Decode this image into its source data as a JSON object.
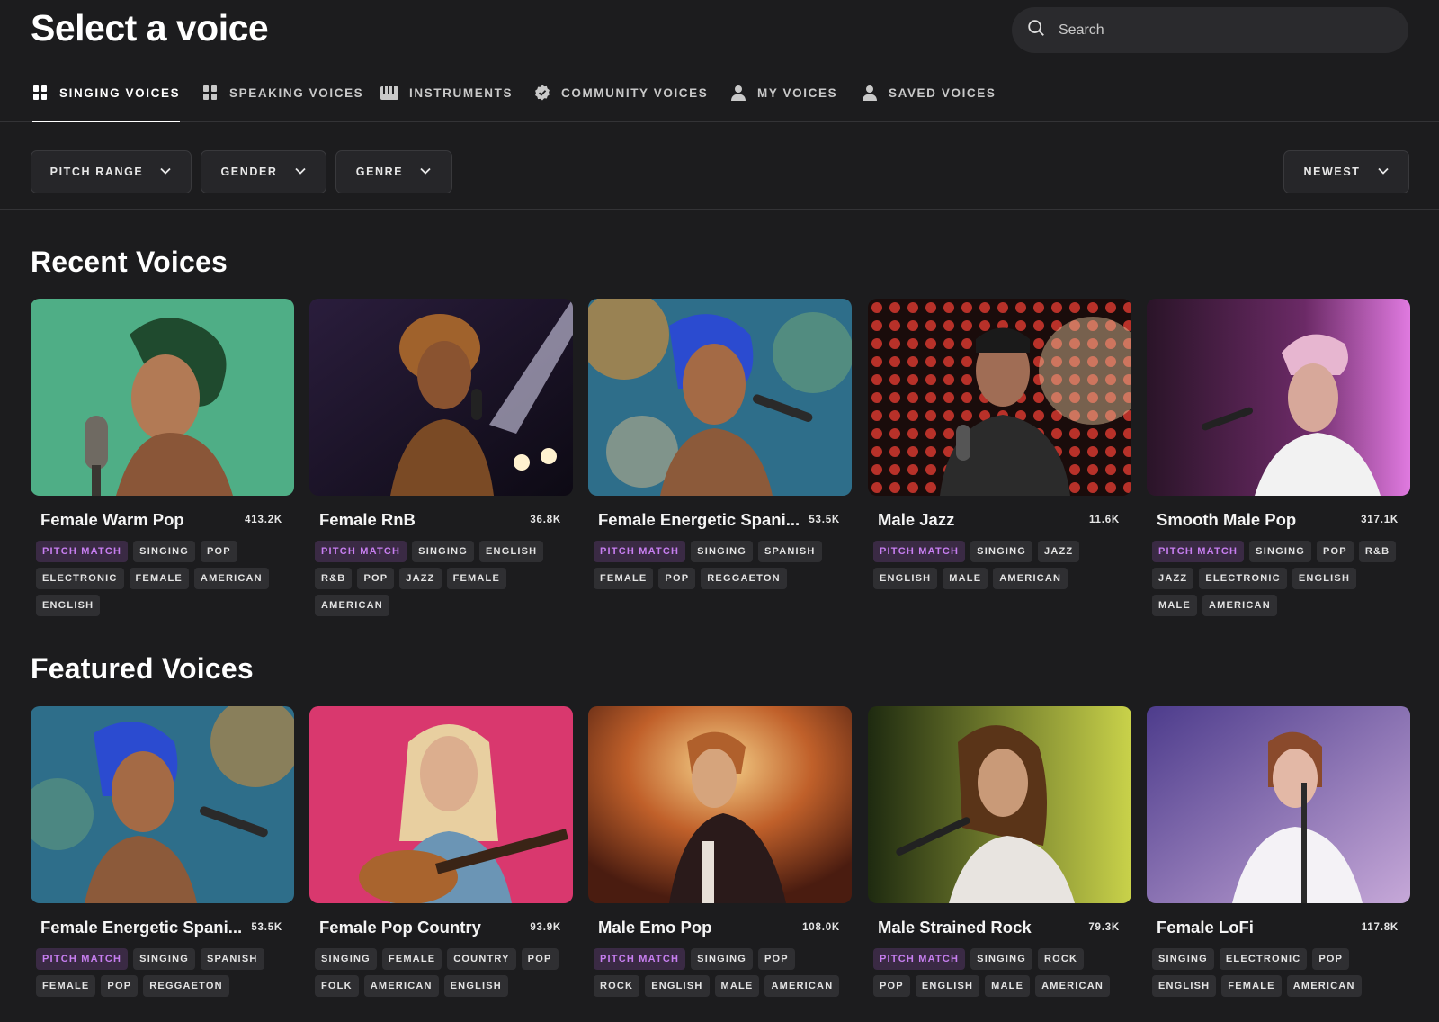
{
  "header": {
    "title": "Select a voice",
    "search_placeholder": "Search"
  },
  "tabs": [
    {
      "label": "SINGING VOICES",
      "icon": "mic-grid-icon",
      "active": true
    },
    {
      "label": "SPEAKING VOICES",
      "icon": "mic-grid-icon",
      "active": false
    },
    {
      "label": "INSTRUMENTS",
      "icon": "piano-icon",
      "active": false
    },
    {
      "label": "COMMUNITY VOICES",
      "icon": "verified-badge-icon",
      "active": false
    },
    {
      "label": "MY VOICES",
      "icon": "person-icon",
      "active": false
    },
    {
      "label": "SAVED VOICES",
      "icon": "person-icon",
      "active": false
    }
  ],
  "filters": {
    "pitch_range": "PITCH RANGE",
    "gender": "GENDER",
    "genre": "GENRE",
    "sort": "NEWEST"
  },
  "sections": {
    "recent": {
      "title": "Recent Voices",
      "cards": [
        {
          "name": "Female Warm Pop",
          "count": "413.2K",
          "tags": [
            "PITCH MATCH",
            "SINGING",
            "POP",
            "ELECTRONIC",
            "FEMALE",
            "AMERICAN",
            "ENGLISH"
          ]
        },
        {
          "name": "Female RnB",
          "count": "36.8K",
          "tags": [
            "PITCH MATCH",
            "SINGING",
            "ENGLISH",
            "R&B",
            "POP",
            "JAZZ",
            "FEMALE",
            "AMERICAN"
          ]
        },
        {
          "name": "Female Energetic Spani...",
          "count": "53.5K",
          "tags": [
            "PITCH MATCH",
            "SINGING",
            "SPANISH",
            "FEMALE",
            "POP",
            "REGGAETON"
          ]
        },
        {
          "name": "Male Jazz",
          "count": "11.6K",
          "tags": [
            "PITCH MATCH",
            "SINGING",
            "JAZZ",
            "ENGLISH",
            "MALE",
            "AMERICAN"
          ]
        },
        {
          "name": "Smooth Male Pop",
          "count": "317.1K",
          "tags": [
            "PITCH MATCH",
            "SINGING",
            "POP",
            "R&B",
            "JAZZ",
            "ELECTRONIC",
            "ENGLISH",
            "MALE",
            "AMERICAN"
          ]
        }
      ]
    },
    "featured": {
      "title": "Featured Voices",
      "cards": [
        {
          "name": "Female Energetic Spani...",
          "count": "53.5K",
          "tags": [
            "PITCH MATCH",
            "SINGING",
            "SPANISH",
            "FEMALE",
            "POP",
            "REGGAETON"
          ]
        },
        {
          "name": "Female Pop Country",
          "count": "93.9K",
          "tags": [
            "SINGING",
            "FEMALE",
            "COUNTRY",
            "POP",
            "FOLK",
            "AMERICAN",
            "ENGLISH"
          ]
        },
        {
          "name": "Male Emo Pop",
          "count": "108.0K",
          "tags": [
            "PITCH MATCH",
            "SINGING",
            "POP",
            "ROCK",
            "ENGLISH",
            "MALE",
            "AMERICAN"
          ]
        },
        {
          "name": "Male Strained Rock",
          "count": "79.3K",
          "tags": [
            "PITCH MATCH",
            "SINGING",
            "ROCK",
            "POP",
            "ENGLISH",
            "MALE",
            "AMERICAN"
          ]
        },
        {
          "name": "Female LoFi",
          "count": "117.8K",
          "tags": [
            "SINGING",
            "ELECTRONIC",
            "POP",
            "ENGLISH",
            "FEMALE",
            "AMERICAN"
          ]
        }
      ]
    }
  },
  "colors": {
    "background": "#1c1c1e",
    "pitch_match_text": "#c77ef0",
    "pitch_match_bg": "#3a2a44"
  }
}
